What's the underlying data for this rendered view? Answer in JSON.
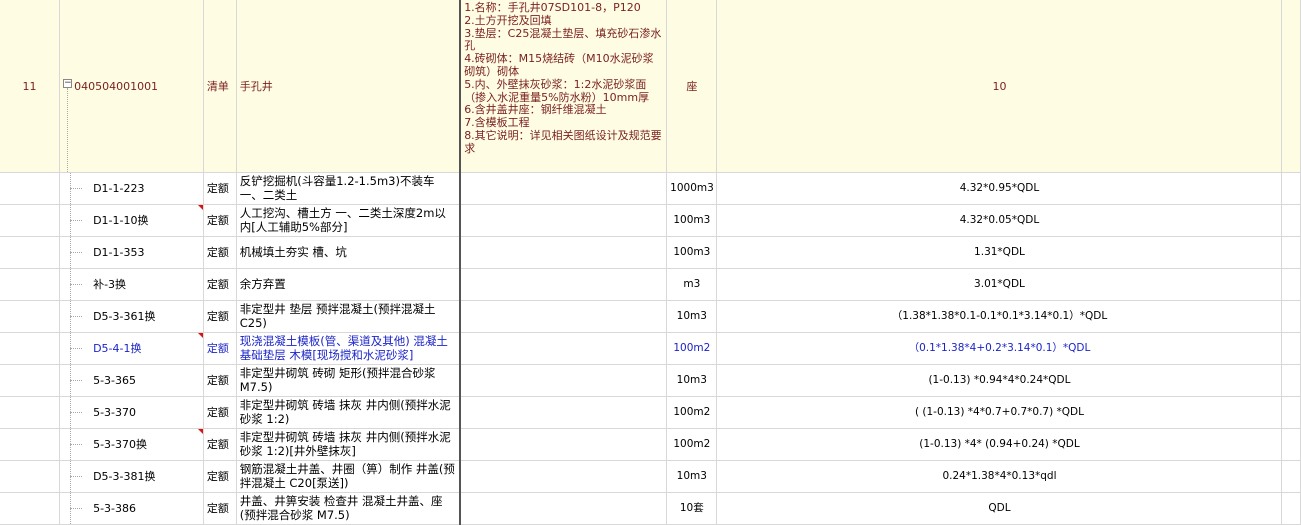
{
  "main_row": {
    "index": "11",
    "code": "040504001001",
    "type": "清单",
    "name": "手孔井",
    "features": [
      "1.名称：手孔井07SD101-8，P120",
      "2.土方开挖及回填",
      "3.垫层：C25混凝土垫层、填充砂石渗水孔",
      "4.砖砌体：M15烧结砖（M10水泥砂浆砌筑）砌体",
      "5.内、外壁抹灰砂浆：1:2水泥砂浆面（掺入水泥重量5%防水粉）10mm厚",
      "6.含井盖井座：钢纤维混凝土",
      "7.含模板工程",
      "8.其它说明：详见相关图纸设计及规范要求"
    ],
    "unit": "座",
    "quantity": "10"
  },
  "sub_rows": [
    {
      "code": "D1-1-223",
      "type": "定额",
      "name": "反铲挖掘机(斗容量1.2-1.5m3)不装车 一、二类土",
      "unit": "1000m3",
      "quantity": "4.32*0.95*QDL",
      "marked": false,
      "highlight": false
    },
    {
      "code": "D1-1-10换",
      "type": "定额",
      "name": "人工挖沟、槽土方 一、二类土深度2m以内[人工辅助5%部分]",
      "unit": "100m3",
      "quantity": "4.32*0.05*QDL",
      "marked": true,
      "highlight": false
    },
    {
      "code": "D1-1-353",
      "type": "定额",
      "name": "机械填土夯实 槽、坑",
      "unit": "100m3",
      "quantity": "1.31*QDL",
      "marked": false,
      "highlight": false
    },
    {
      "code": "补-3换",
      "type": "定额",
      "name": "余方弃置",
      "unit": "m3",
      "quantity": "3.01*QDL",
      "marked": false,
      "highlight": false
    },
    {
      "code": "D5-3-361换",
      "type": "定额",
      "name": "非定型井 垫层 预拌混凝土(预拌混凝土 C25)",
      "unit": "10m3",
      "quantity": "（1.38*1.38*0.1-0.1*0.1*3.14*0.1）*QDL",
      "marked": false,
      "highlight": false
    },
    {
      "code": "D5-4-1换",
      "type": "定额",
      "name": "现浇混凝土模板(管、渠道及其他) 混凝土基础垫层 木模[现场搅和水泥砂浆]",
      "unit": "100m2",
      "quantity": "（0.1*1.38*4+0.2*3.14*0.1）*QDL",
      "marked": true,
      "highlight": true
    },
    {
      "code": "5-3-365",
      "type": "定额",
      "name": "非定型井砌筑 砖砌 矩形(预拌混合砂浆 M7.5)",
      "unit": "10m3",
      "quantity": "(1-0.13) *0.94*4*0.24*QDL",
      "marked": false,
      "highlight": false
    },
    {
      "code": "5-3-370",
      "type": "定额",
      "name": "非定型井砌筑 砖墙 抹灰 井内侧(预拌水泥砂浆 1:2)",
      "unit": "100m2",
      "quantity": "( (1-0.13) *4*0.7+0.7*0.7) *QDL",
      "marked": false,
      "highlight": false
    },
    {
      "code": "5-3-370换",
      "type": "定额",
      "name": "非定型井砌筑 砖墙 抹灰 井内侧(预拌水泥砂浆 1:2)[井外壁抹灰]",
      "unit": "100m2",
      "quantity": "(1-0.13) *4* (0.94+0.24) *QDL",
      "marked": true,
      "highlight": false
    },
    {
      "code": "D5-3-381换",
      "type": "定额",
      "name": "钢筋混凝土井盖、井圈（箅）制作 井盖(预拌混凝土 C20[泵送])",
      "unit": "10m3",
      "quantity": "0.24*1.38*4*0.13*qdl",
      "marked": false,
      "highlight": false
    },
    {
      "code": "5-3-386",
      "type": "定额",
      "name": "井盖、井箅安装 检查井 混凝土井盖、座(预拌混合砂浆 M7.5)",
      "unit": "10套",
      "quantity": "QDL",
      "marked": false,
      "highlight": false
    }
  ],
  "colors": {
    "main_bg": "#fefde3",
    "main_text": "#7a1f1f",
    "highlight_text": "#1b24c8",
    "marker": "#dd1111"
  }
}
